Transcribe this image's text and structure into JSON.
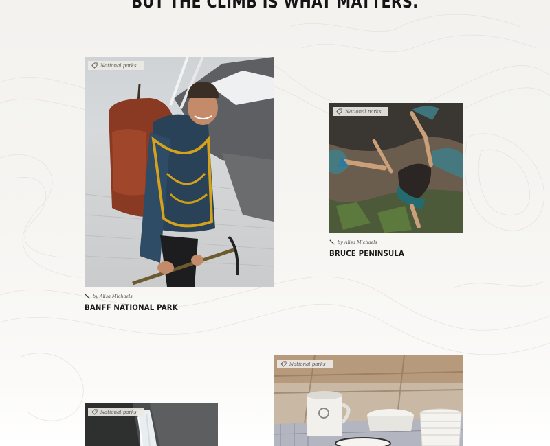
{
  "headline": "BUT THE CLIMB IS WHAT MATTERS.",
  "colors": {
    "background": "#f5f4f1",
    "title": "#1a1a1a",
    "tag_bg": "#ebe9e4",
    "meta_text": "#555555"
  },
  "cards": [
    {
      "tag": "National parks",
      "photo": "hiker-with-backpack-and-ice-axe-on-glacier",
      "byline": "by Alisa Michaels",
      "title": "BANFF NATIONAL PARK"
    },
    {
      "tag": "National parks",
      "photo": "woman-bouldering-on-rock-face",
      "byline": "by Alisa Michaels",
      "title": "BRUCE PENINSULA"
    },
    {
      "tag": "National parks",
      "photo": "waterfall-by-rock-cliff"
    },
    {
      "tag": "National parks",
      "photo": "enamel-camping-mugs-and-plates-on-table"
    }
  ]
}
